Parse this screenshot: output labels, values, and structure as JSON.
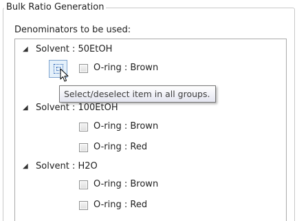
{
  "groupbox": {
    "title": "Bulk Ratio Generation",
    "subtitle": "Denominators to be used:"
  },
  "tree": {
    "groups": [
      {
        "label": "Solvent : 50EtOH",
        "expanded": true,
        "items": [
          {
            "label": "O-ring : Brown",
            "checked": false
          }
        ]
      },
      {
        "label": "Solvent : 100EtOH",
        "expanded": true,
        "items": [
          {
            "label": "O-ring : Brown",
            "checked": false
          },
          {
            "label": "O-ring : Red",
            "checked": false
          }
        ]
      },
      {
        "label": "Solvent : H2O",
        "expanded": true,
        "items": [
          {
            "label": "O-ring : Brown",
            "checked": false
          },
          {
            "label": "O-ring : Red",
            "checked": false
          }
        ]
      }
    ]
  },
  "tooltip": {
    "text": "Select/deselect item in all groups."
  },
  "icons": {
    "expander": "triangle-down-expanded-icon",
    "select_all": "select-all-toggle-icon",
    "cursor": "arrow-pointer-icon"
  },
  "colors": {
    "tooltip_border": "#767676",
    "highlight_fill": "#e5f1fb",
    "highlight_border": "#7da2ce"
  }
}
